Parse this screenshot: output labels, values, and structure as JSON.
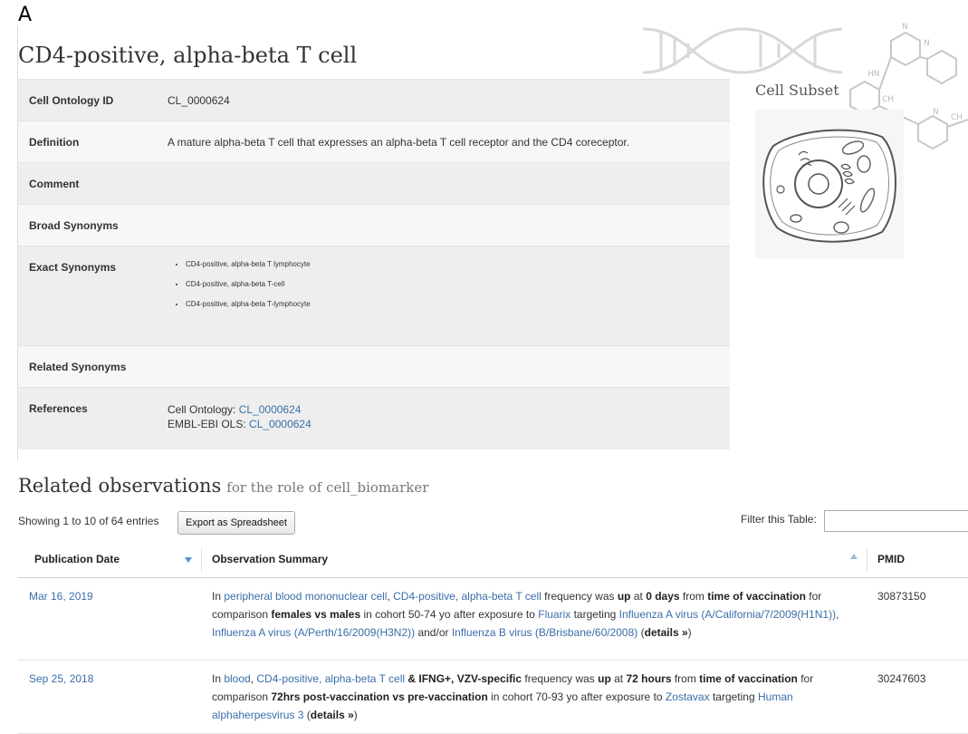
{
  "panel_label": "A",
  "title": "CD4-positive, alpha-beta T cell",
  "info_rows": {
    "cell_ontology_id": {
      "label": "Cell Ontology ID",
      "value": "CL_0000624"
    },
    "definition": {
      "label": "Definition",
      "value": "A mature alpha-beta T cell that expresses an alpha-beta T cell receptor and the CD4 coreceptor."
    },
    "comment": {
      "label": "Comment",
      "value": ""
    },
    "broad_synonyms": {
      "label": "Broad Synonyms",
      "value": ""
    },
    "exact_synonyms": {
      "label": "Exact Synonyms",
      "items": [
        "CD4-positive, alpha-beta T lymphocyte",
        "CD4-positive, alpha-beta T-cell",
        "CD4-positive, alpha-beta T-lymphocyte"
      ]
    },
    "related_synonyms": {
      "label": "Related Synonyms",
      "value": ""
    },
    "references": {
      "label": "References",
      "line1_prefix": "Cell Ontology: ",
      "line1_link": "CL_0000624",
      "line2_prefix": "EMBL-EBI OLS: ",
      "line2_link": "CL_0000624"
    }
  },
  "cell_subset_title": "Cell Subset",
  "related": {
    "title": "Related observations",
    "subtitle": "for the role of cell_biomarker",
    "entries_text": "Showing 1 to 10 of 64 entries",
    "export_label": "Export as Spreadsheet",
    "filter_label": "Filter this Table:",
    "filter_value": "",
    "columns": [
      "Publication Date",
      "Observation Summary",
      "PMID"
    ],
    "rows": [
      {
        "date": "Mar 16, 2019",
        "pmid": "30873150",
        "s": {
          "in": "In ",
          "tissue": "peripheral blood mononuclear cell",
          "comma": ", ",
          "cell": "CD4-positive, alpha-beta T cell",
          "t1": " frequency was ",
          "dir": "up",
          "t2": " at ",
          "time": "0 days",
          "t3": " from ",
          "ref": "time of vaccination",
          "t4": " for comparison ",
          "comp": "females vs males",
          "t5": " in cohort 50-74 yo after exposure to ",
          "vaccine": "Fluarix",
          "t6": " targeting ",
          "target1": "Influenza A virus (A/California/7/2009(H1N1))",
          "sep1": ", ",
          "target2": "Influenza A virus (A/Perth/16/2009(H3N2))",
          "t7": " and/or ",
          "target3": "Influenza B virus (B/Brisbane/60/2008)",
          "t8": " (",
          "details": "details »",
          "t9": ")"
        }
      },
      {
        "date": "Sep 25, 2018",
        "pmid": "30247603",
        "s": {
          "in": "In ",
          "tissue": "blood",
          "comma": ", ",
          "cell": "CD4-positive, alpha-beta T cell",
          "markers": " & IFNG+, VZV-specific",
          "t1": " frequency was ",
          "dir": "up",
          "t2": " at ",
          "time": "72 hours",
          "t3": " from ",
          "ref": "time of vaccination",
          "t4": " for comparison ",
          "comp": "72hrs post-vaccination vs pre-vaccination",
          "t5": " in cohort 70-93 yo after exposure to ",
          "vaccine": "Zostavax",
          "t6": " targeting ",
          "target1": "Human alphaherpesvirus 3",
          "t8": " (",
          "details": "details »",
          "t9": ")"
        }
      }
    ]
  }
}
